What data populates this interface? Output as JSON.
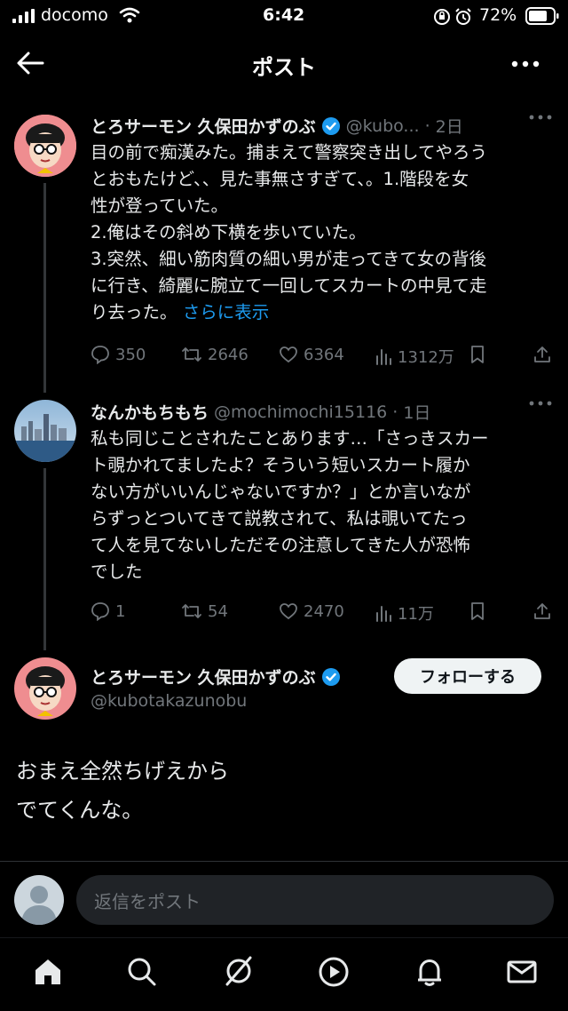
{
  "status_bar": {
    "carrier": "docomo",
    "time": "6:42",
    "battery_percent": "72%"
  },
  "header": {
    "title": "ポスト",
    "back_icon": "arrow-left-icon",
    "more_icon": "more-horizontal-icon"
  },
  "parent_post": {
    "display_name": "とろサーモン 久保田かずのぶ",
    "handle_short": "@kubo...",
    "time": "2日",
    "text": "目の前で痴漢みた。捕まえて警察突き出してやろう\nとおもたけど、、見た事無さすぎて、。1.階段を女\n性が登っていた。\n2.俺はその斜め下横を歩いていた。\n3.突然、細い筋肉質の細い男が走ってきて女の背後\nに行き、綺麗に腕立て一回してスカートの中見て走\nり去った。",
    "show_more": "さらに表示",
    "replies": "350",
    "reposts": "2646",
    "likes": "6364",
    "views": "1312万"
  },
  "reply_post": {
    "display_name": "なんかもちもち",
    "handle": "@mochimochi15116",
    "time": "1日",
    "text": "私も同じことされたことあります…「さっきスカー\nト覗かれてましたよ？そういう短いスカート履か\nない方がいいんじゃないですか？」とか言いなが\nらずっとついてきて説教されて、私は覗いてたっ\nて人を見てないしただその注意してきた人が恐怖\nでした",
    "replies": "1",
    "reposts": "54",
    "likes": "2470",
    "views": "11万"
  },
  "main_post": {
    "display_name": "とろサーモン 久保田かずのぶ",
    "handle": "@kubotakazunobu",
    "follow_label": "フォローする",
    "text": "おまえ全然ちげえから\nでてくんな。"
  },
  "reply_bar": {
    "placeholder": "返信をポスト"
  },
  "tab_bar": {
    "items": [
      "home-icon",
      "search-icon",
      "grok-icon",
      "video-icon",
      "notifications-icon",
      "messages-icon"
    ]
  },
  "colors": {
    "background": "#000000",
    "text": "#e7e9ea",
    "secondary": "#71767b",
    "accent": "#1d9bf0",
    "verified": "#1d9bf0"
  }
}
